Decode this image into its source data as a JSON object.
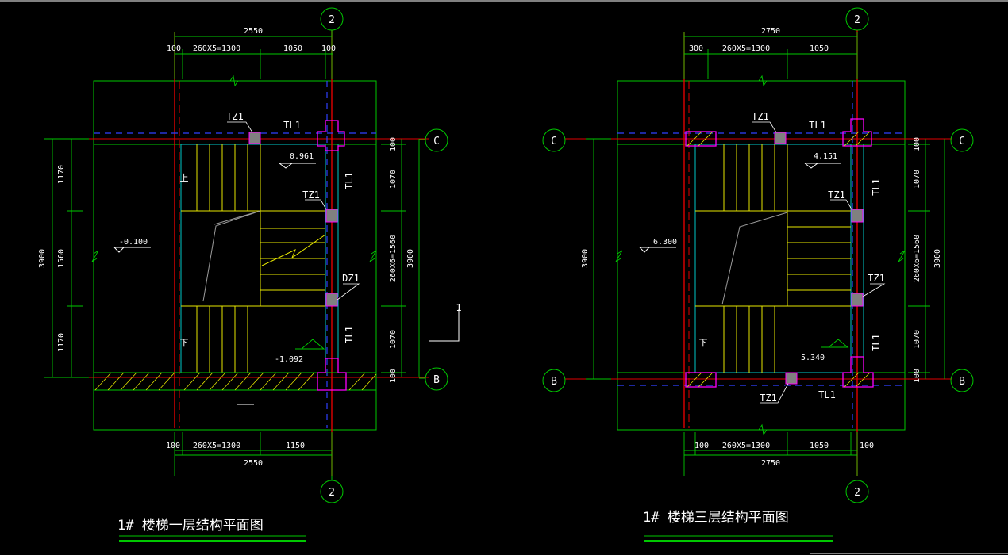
{
  "colors": {
    "background": "#000000",
    "dimension": "#00c800",
    "stair": "#e6e600",
    "wall": "#00c8c8",
    "axis": "#e00000",
    "dashed_beam": "#3040ff",
    "column": "#ff00ff",
    "text": "#ffffff"
  },
  "plan1": {
    "title": "1# 楼梯一层结构平面图",
    "dim_top_total": "2550",
    "dim_top_a": "100",
    "dim_top_b": "260X5=1300",
    "dim_top_c": "1050",
    "dim_top_d": "100",
    "dim_bottom_total": "2550",
    "dim_bottom_a": "100",
    "dim_bottom_b": "260X5=1300",
    "dim_bottom_c": "1150",
    "left_total": "3900",
    "left_a": "1170",
    "left_b": "1560",
    "left_c": "1170",
    "right_a": "100",
    "right_b": "1070",
    "right_c": "260X6=1560",
    "right_d": "1070",
    "right_e": "100",
    "right_total": "3900",
    "axis_top": "2",
    "axis_bottom": "2",
    "axis_c": "C",
    "axis_b": "B",
    "tz1_a": "TZ1",
    "tl1_top": "TL1",
    "elev_a": "0.961",
    "tz1_b": "TZ1",
    "tl1_right_a": "TL1",
    "elev_left": "-0.100",
    "dz1": "DZ1",
    "tl1_right_b": "TL1",
    "elev_b": "-1.092",
    "up_mark": "上",
    "down_mark": "下",
    "section_mark": "1"
  },
  "plan2": {
    "title": "1# 楼梯三层结构平面图",
    "dim_top_total": "2750",
    "dim_top_a": "300",
    "dim_top_b": "260X5=1300",
    "dim_top_c": "1050",
    "dim_bottom_total": "2750",
    "dim_bottom_a": "100",
    "dim_bottom_b": "260X5=1300",
    "dim_bottom_c": "1050",
    "dim_bottom_d": "100",
    "left_total": "3900",
    "right_a": "100",
    "right_b": "1070",
    "right_c": "260X6=1560",
    "right_d": "1070",
    "right_e": "100",
    "right_total": "3900",
    "axis_top": "2",
    "axis_bottom": "2",
    "axis_c_left": "C",
    "axis_c_right": "C",
    "axis_b_left": "B",
    "axis_b_right": "B",
    "tz1_a": "TZ1",
    "tl1_top": "TL1",
    "elev_a": "4.151",
    "tz1_b": "TZ1",
    "tl1_right_a": "TL1",
    "elev_left": "6.300",
    "tz1_c": "TZ1",
    "tl1_right_b": "TL1",
    "elev_b": "5.340",
    "tz1_d": "TZ1",
    "tl1_bottom": "TL1",
    "down_mark": "下"
  }
}
